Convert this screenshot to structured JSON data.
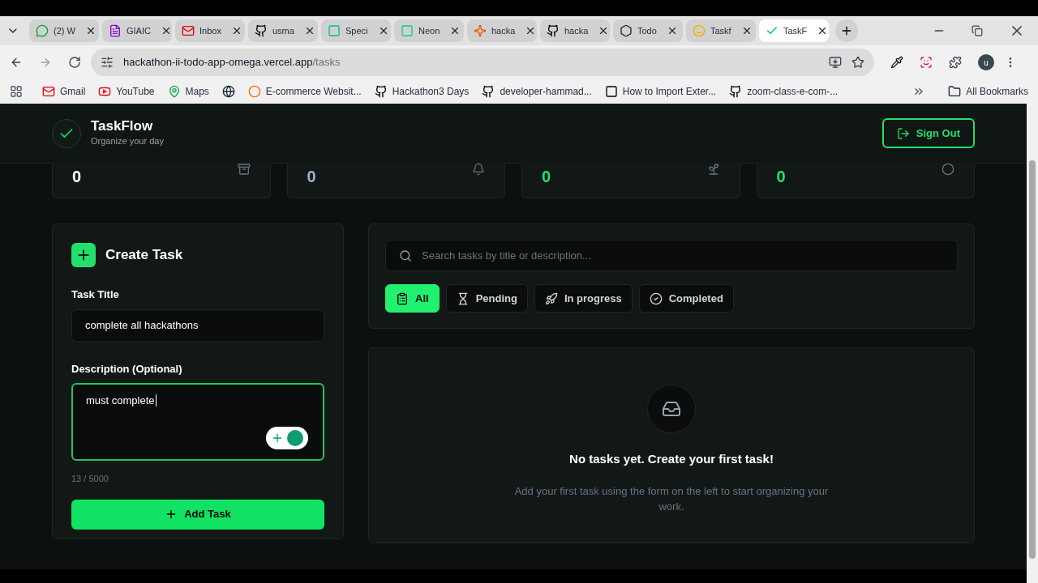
{
  "browser": {
    "tabs": [
      {
        "title": "(2) W",
        "selected": false
      },
      {
        "title": "GIAIC",
        "selected": false
      },
      {
        "title": "Inbox",
        "selected": false
      },
      {
        "title": "usma",
        "selected": false
      },
      {
        "title": "Speci",
        "selected": false
      },
      {
        "title": "Neon",
        "selected": false
      },
      {
        "title": "hacka",
        "selected": false
      },
      {
        "title": "hacka",
        "selected": false
      },
      {
        "title": "Todo",
        "selected": false
      },
      {
        "title": "Taskf",
        "selected": false
      },
      {
        "title": "TaskF",
        "selected": true
      }
    ],
    "url_host": "hackathon-ii-todo-app-omega.vercel.app",
    "url_path": "/tasks",
    "profile": "u",
    "bookmarks": [
      {
        "kind": "link",
        "title": "Gmail"
      },
      {
        "kind": "link",
        "title": "YouTube"
      },
      {
        "kind": "link",
        "title": "Maps"
      },
      {
        "kind": "icon-only"
      },
      {
        "kind": "link",
        "title": "E-commerce Websit..."
      },
      {
        "kind": "link",
        "title": "Hackathon3 Days"
      },
      {
        "kind": "link",
        "title": "developer-hammad..."
      },
      {
        "kind": "link",
        "title": "How to Import Exter..."
      },
      {
        "kind": "link",
        "title": "zoom-class-e-com-..."
      }
    ],
    "all_bookmarks": "All Bookmarks"
  },
  "app": {
    "name": "TaskFlow",
    "tagline": "Organize your day",
    "sign_out": "Sign Out"
  },
  "stats": [
    {
      "value": "0",
      "color": "#ffffff"
    },
    {
      "value": "0",
      "color": "#9fb4c8"
    },
    {
      "value": "0",
      "color": "#22e06b"
    },
    {
      "value": "0",
      "color": "#22e06b"
    }
  ],
  "create": {
    "title": "Create Task",
    "title_label": "Task Title",
    "title_value": "complete all hackathons",
    "desc_label": "Description (Optional)",
    "desc_value": "must complete",
    "counter": "13 / 5000",
    "submit": "Add Task"
  },
  "search": {
    "placeholder": "Search tasks by title or description..."
  },
  "filters": [
    {
      "label": "All",
      "selected": true
    },
    {
      "label": "Pending",
      "selected": false
    },
    {
      "label": "In progress",
      "selected": false
    },
    {
      "label": "Completed",
      "selected": false
    }
  ],
  "empty": {
    "title": "No tasks yet. Create your first task!",
    "text": "Add your first task using the form on the left to start organizing your work."
  }
}
